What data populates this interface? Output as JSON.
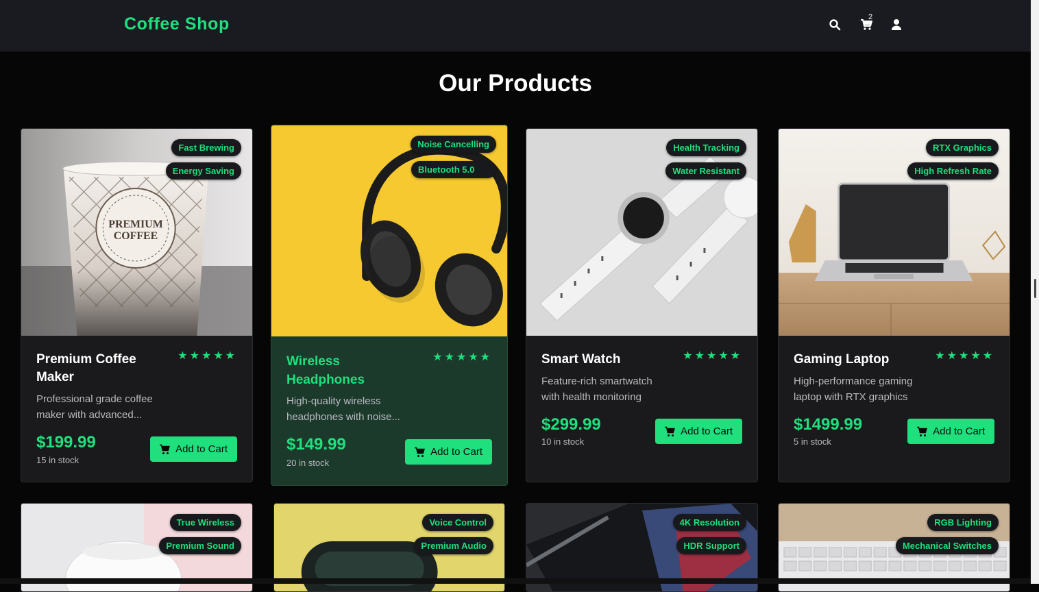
{
  "header": {
    "brand": "Coffee Shop",
    "cart_count": "2"
  },
  "main": {
    "title": "Our Products"
  },
  "products": [
    {
      "name": "Premium Coffee Maker",
      "name_lines": [
        "Premium Coffee",
        "Maker"
      ],
      "desc_lines": [
        "Professional grade coffee",
        "maker with advanced..."
      ],
      "price": "$199.99",
      "stock": "15 in stock",
      "badges": [
        "Fast Brewing",
        "Energy Saving"
      ],
      "stars": "★★★★★",
      "button": "Add to Cart",
      "image": "coffee-cup-photo",
      "cup_text": [
        "PREMIUM",
        "COFFEE"
      ]
    },
    {
      "name": "Wireless Headphones",
      "name_lines": [
        "Wireless",
        "Headphones"
      ],
      "desc_lines": [
        "High-quality wireless",
        "headphones with noise..."
      ],
      "price": "$149.99",
      "stock": "20 in stock",
      "badges": [
        "Noise Cancelling",
        "Bluetooth 5.0"
      ],
      "stars": "★★★★★",
      "button": "Add to Cart",
      "image": "headphones-photo"
    },
    {
      "name": "Smart Watch",
      "desc_lines": [
        "Feature-rich smartwatch",
        "with health monitoring"
      ],
      "price": "$299.99",
      "stock": "10 in stock",
      "badges": [
        "Health Tracking",
        "Water Resistant"
      ],
      "stars": "★★★★★",
      "button": "Add to Cart",
      "image": "smartwatch-photo"
    },
    {
      "name": "Gaming Laptop",
      "desc_lines": [
        "High-performance gaming",
        "laptop with RTX graphics"
      ],
      "price": "$1499.99",
      "stock": "5 in stock",
      "badges": [
        "RTX Graphics",
        "High Refresh Rate"
      ],
      "stars": "★★★★★",
      "button": "Add to Cart",
      "image": "laptop-photo"
    },
    {
      "badges": [
        "True Wireless",
        "Premium Sound"
      ],
      "image": "earbuds-photo"
    },
    {
      "badges": [
        "Voice Control",
        "Premium Audio"
      ],
      "image": "speaker-photo"
    },
    {
      "badges": [
        "4K Resolution",
        "HDR Support"
      ],
      "image": "tablet-photo"
    },
    {
      "badges": [
        "RGB Lighting",
        "Mechanical Switches"
      ],
      "image": "keyboard-photo"
    }
  ],
  "colors": {
    "accent": "#1fe07d",
    "background": "#060607",
    "card": "#1a1a1c",
    "card_highlight": "#1c3a2c"
  }
}
